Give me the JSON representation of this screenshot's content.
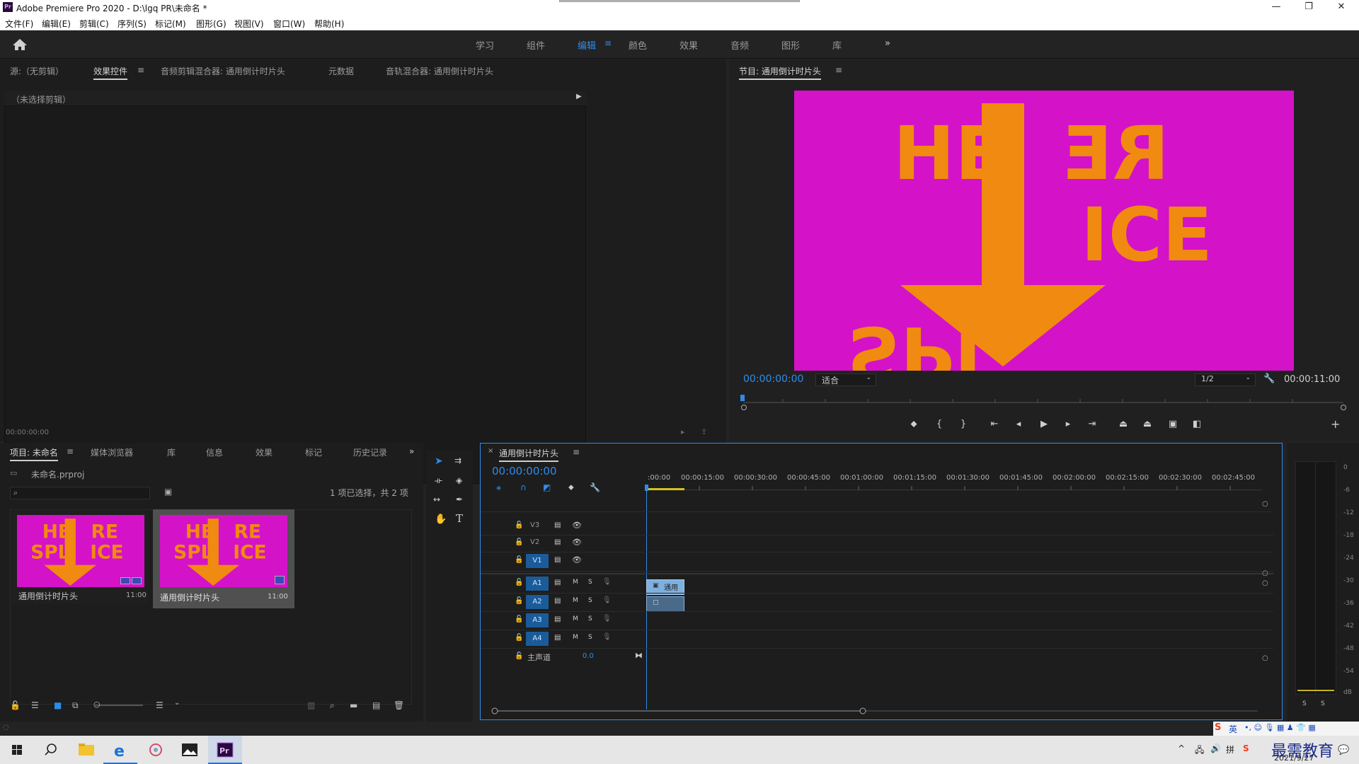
{
  "window": {
    "title": "Adobe Premiere Pro 2020 - D:\\lgq PR\\未命名 *",
    "app_icon": "Pr",
    "minimize": "—",
    "maximize": "❐",
    "close": "✕"
  },
  "menu": [
    "文件(F)",
    "编辑(E)",
    "剪辑(C)",
    "序列(S)",
    "标记(M)",
    "图形(G)",
    "视图(V)",
    "窗口(W)",
    "帮助(H)"
  ],
  "workspaces": {
    "items": [
      "学习",
      "组件",
      "编辑",
      "颜色",
      "效果",
      "音频",
      "图形",
      "库"
    ],
    "active": "编辑",
    "more": "»"
  },
  "source_panel": {
    "tabs": [
      "源:（无剪辑）",
      "效果控件",
      "音频剪辑混合器: 通用倒计时片头",
      "元数据",
      "音轨混合器: 通用倒计时片头"
    ],
    "active_tab": "效果控件",
    "no_clip_text": "（未选择剪辑）",
    "timecode": "00:00:00:00"
  },
  "program_monitor": {
    "title": "节目: 通用倒计时片头",
    "frame_line1_left": "HE",
    "frame_line1_right": "RE",
    "frame_line2_left": "SPL",
    "frame_line2_right": "ICE",
    "current_timecode": "00:00:00:00",
    "zoom": "适合",
    "resolution": "1/2",
    "duration": "00:00:11:00"
  },
  "project_panel": {
    "tabs": [
      "项目: 未命名",
      "媒体浏览器",
      "库",
      "信息",
      "效果",
      "标记",
      "历史记录"
    ],
    "active_tab": "项目: 未命名",
    "file_name": "未命名.prproj",
    "selection_status": "1 项已选择，共 2 项",
    "items": [
      {
        "name": "通用倒计时片头",
        "duration": "11:00"
      },
      {
        "name": "通用倒计时片头",
        "duration": "11:00"
      }
    ]
  },
  "timeline": {
    "title": "通用倒计时片头",
    "timecode": "00:00:00:00",
    "ruler": [
      ":00:00",
      "00:00:15:00",
      "00:00:30:00",
      "00:00:45:00",
      "00:01:00:00",
      "00:01:15:00",
      "00:01:30:00",
      "00:01:45:00",
      "00:02:00:00",
      "00:02:15:00",
      "00:02:30:00",
      "00:02:45:00"
    ],
    "video_tracks": [
      "V3",
      "V2",
      "V1"
    ],
    "audio_tracks": [
      "A1",
      "A2",
      "A3",
      "A4"
    ],
    "master_label": "主声道",
    "master_value": "0.0",
    "mute": "M",
    "solo": "S",
    "clip_label": "通用"
  },
  "audio_meter": {
    "scale": [
      "0",
      "-6",
      "-12",
      "-18",
      "-24",
      "-30",
      "-36",
      "-42",
      "-48",
      "-54",
      "dB"
    ],
    "solo_buttons": [
      "S",
      "S"
    ]
  },
  "taskbar": {
    "time": "2021/9/27",
    "ime": "英",
    "watermark": "最需教育"
  }
}
